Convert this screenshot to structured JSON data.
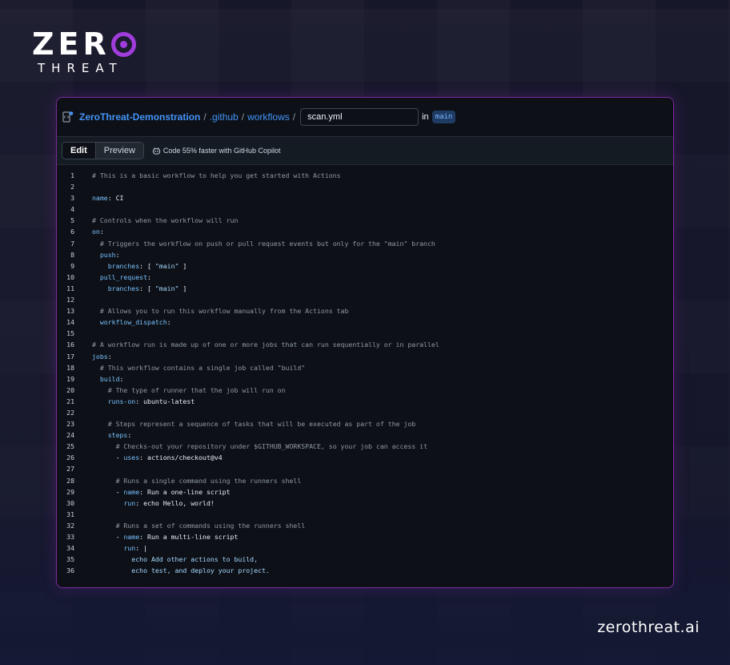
{
  "logo": {
    "zero": "ZER",
    "threat": "THREAT"
  },
  "header": {
    "repo": "ZeroThreat-Demonstration",
    "path": [
      ".github",
      "workflows"
    ],
    "separator": "/",
    "filename": "scan.yml",
    "in_label": "in",
    "branch": "main"
  },
  "toolbar": {
    "edit_tab": "Edit",
    "preview_tab": "Preview",
    "copilot_text": "Code 55% faster with GitHub Copilot"
  },
  "editor": {
    "lines": [
      [
        [
          "comment",
          "# This is a basic workflow to help you get started with Actions"
        ]
      ],
      [],
      [
        [
          "key",
          "name"
        ],
        [
          "plain",
          ": CI"
        ]
      ],
      [],
      [
        [
          "comment",
          "# Controls when the workflow will run"
        ]
      ],
      [
        [
          "key",
          "on"
        ],
        [
          "plain",
          ":"
        ]
      ],
      [
        [
          "plain",
          "  "
        ],
        [
          "comment",
          "# Triggers the workflow on push or pull request events but only for the \"main\" branch"
        ]
      ],
      [
        [
          "plain",
          "  "
        ],
        [
          "key",
          "push"
        ],
        [
          "plain",
          ":"
        ]
      ],
      [
        [
          "plain",
          "    "
        ],
        [
          "key",
          "branches"
        ],
        [
          "plain",
          ": [ "
        ],
        [
          "str",
          "\"main\""
        ],
        [
          "plain",
          " ]"
        ]
      ],
      [
        [
          "plain",
          "  "
        ],
        [
          "key",
          "pull_request"
        ],
        [
          "plain",
          ":"
        ]
      ],
      [
        [
          "plain",
          "    "
        ],
        [
          "key",
          "branches"
        ],
        [
          "plain",
          ": [ "
        ],
        [
          "str",
          "\"main\""
        ],
        [
          "plain",
          " ]"
        ]
      ],
      [],
      [
        [
          "plain",
          "  "
        ],
        [
          "comment",
          "# Allows you to run this workflow manually from the Actions tab"
        ]
      ],
      [
        [
          "plain",
          "  "
        ],
        [
          "key",
          "workflow_dispatch"
        ],
        [
          "plain",
          ":"
        ]
      ],
      [],
      [
        [
          "comment",
          "# A workflow run is made up of one or more jobs that can run sequentially or in parallel"
        ]
      ],
      [
        [
          "key",
          "jobs"
        ],
        [
          "plain",
          ":"
        ]
      ],
      [
        [
          "plain",
          "  "
        ],
        [
          "comment",
          "# This workflow contains a single job called \"build\""
        ]
      ],
      [
        [
          "plain",
          "  "
        ],
        [
          "key",
          "build"
        ],
        [
          "plain",
          ":"
        ]
      ],
      [
        [
          "plain",
          "    "
        ],
        [
          "comment",
          "# The type of runner that the job will run on"
        ]
      ],
      [
        [
          "plain",
          "    "
        ],
        [
          "key",
          "runs-on"
        ],
        [
          "plain",
          ": ubuntu-latest"
        ]
      ],
      [],
      [
        [
          "plain",
          "    "
        ],
        [
          "comment",
          "# Steps represent a sequence of tasks that will be executed as part of the job"
        ]
      ],
      [
        [
          "plain",
          "    "
        ],
        [
          "key",
          "steps"
        ],
        [
          "plain",
          ":"
        ]
      ],
      [
        [
          "plain",
          "      "
        ],
        [
          "comment",
          "# Checks-out your repository under $GITHUB_WORKSPACE, so your job can access it"
        ]
      ],
      [
        [
          "plain",
          "      - "
        ],
        [
          "key",
          "uses"
        ],
        [
          "plain",
          ": actions/checkout@v4"
        ]
      ],
      [],
      [
        [
          "plain",
          "      "
        ],
        [
          "comment",
          "# Runs a single command using the runners shell"
        ]
      ],
      [
        [
          "plain",
          "      - "
        ],
        [
          "key",
          "name"
        ],
        [
          "plain",
          ": Run a one-line script"
        ]
      ],
      [
        [
          "plain",
          "        "
        ],
        [
          "key",
          "run"
        ],
        [
          "plain",
          ": echo Hello, world!"
        ]
      ],
      [],
      [
        [
          "plain",
          "      "
        ],
        [
          "comment",
          "# Runs a set of commands using the runners shell"
        ]
      ],
      [
        [
          "plain",
          "      - "
        ],
        [
          "key",
          "name"
        ],
        [
          "plain",
          ": Run a multi-line script"
        ]
      ],
      [
        [
          "plain",
          "        "
        ],
        [
          "key",
          "run"
        ],
        [
          "plain",
          ": |"
        ]
      ],
      [
        [
          "plain",
          "          "
        ],
        [
          "str",
          "echo Add other actions to build,"
        ]
      ],
      [
        [
          "plain",
          "          "
        ],
        [
          "str",
          "echo test, and deploy your project."
        ]
      ]
    ]
  },
  "brand": "zerothreat.ai",
  "colors": {
    "accent": "#a13ddc",
    "link": "#4493f8",
    "border": "#7a2a9c"
  },
  "icons": {
    "file": "file-code-icon",
    "copilot": "copilot-icon"
  }
}
